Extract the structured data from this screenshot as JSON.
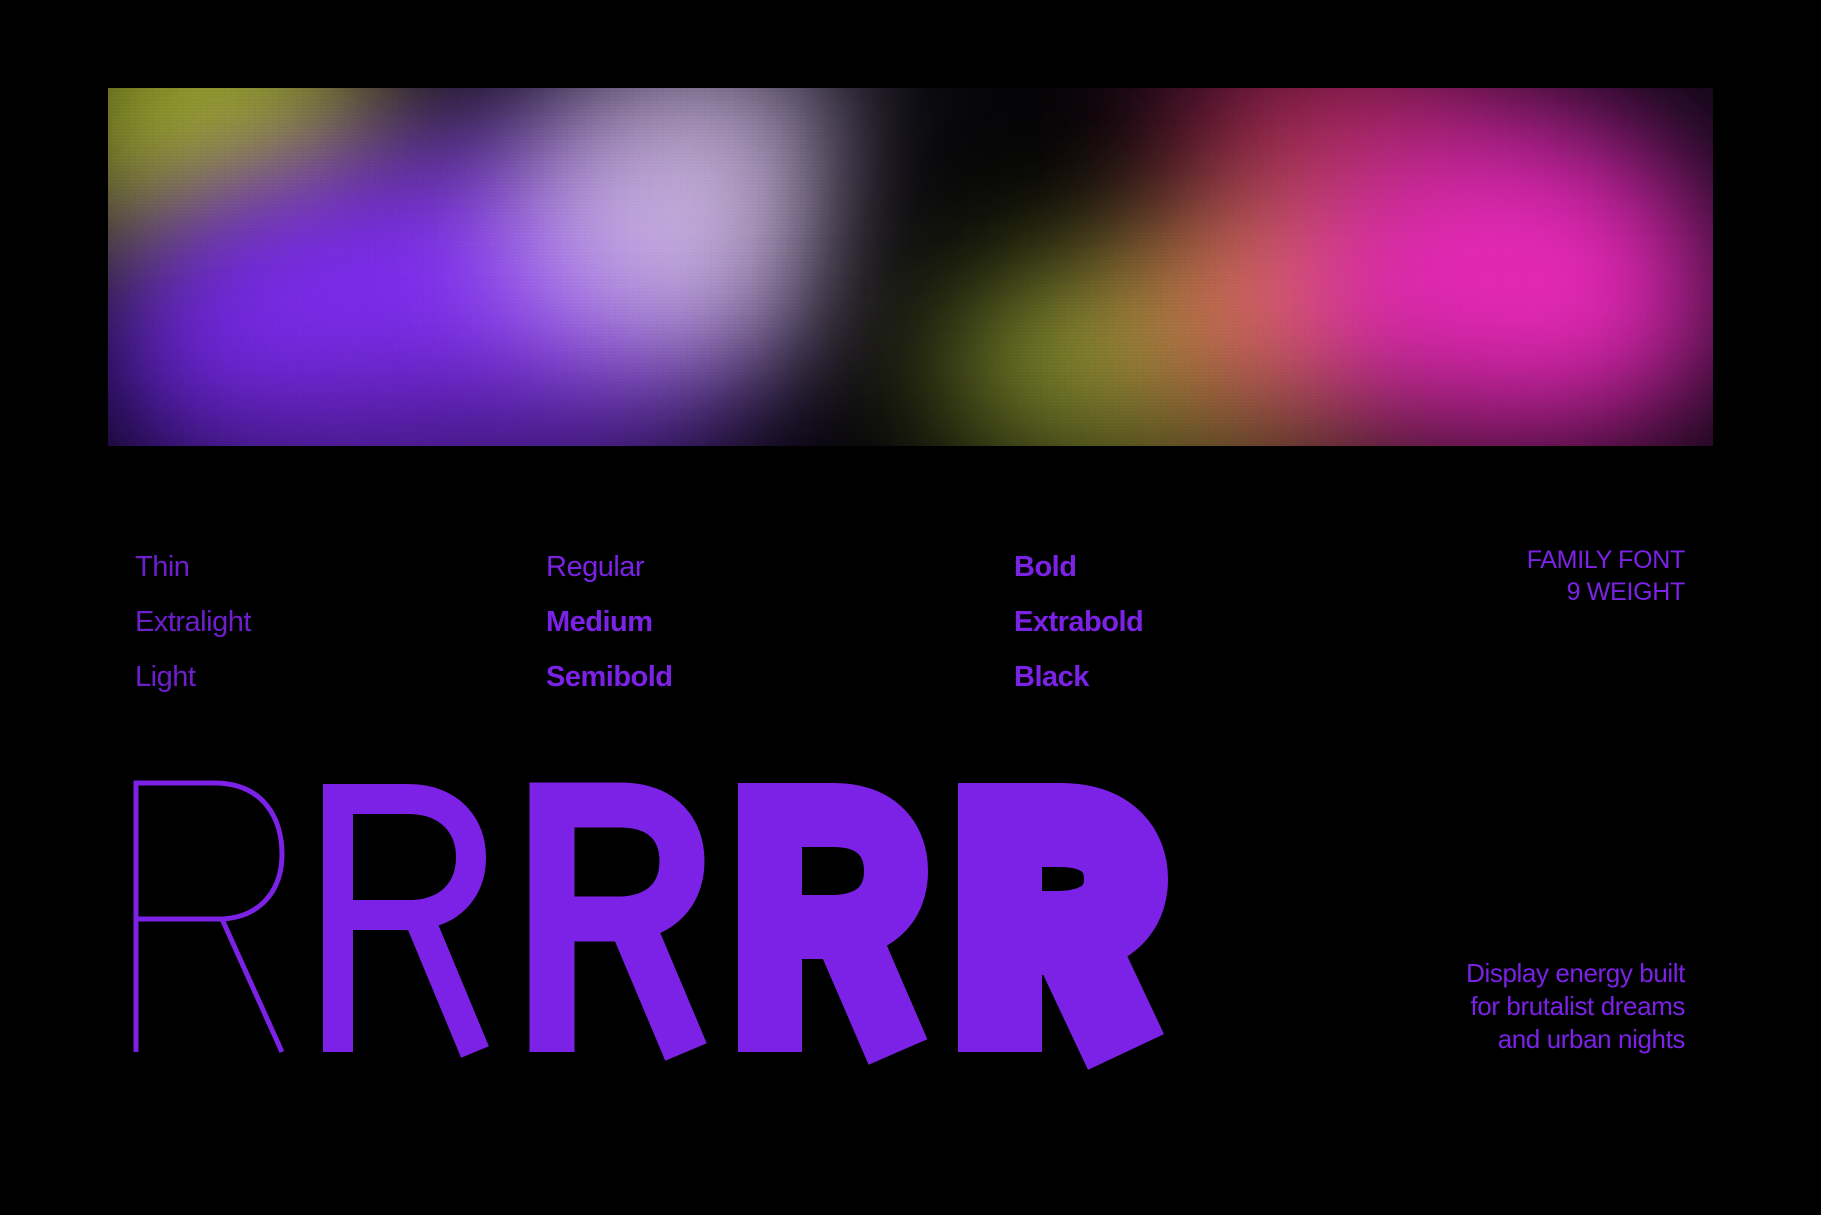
{
  "colors": {
    "background": "#000000",
    "accent": "#7B22E6"
  },
  "banner": {
    "description_icon": "gradient-banner"
  },
  "weights": {
    "column1": [
      "Thin",
      "Extralight",
      "Light"
    ],
    "column2": [
      "Regular",
      "Medium",
      "Semibold"
    ],
    "column3": [
      "Bold",
      "Extrabold",
      "Black"
    ]
  },
  "family": {
    "line1": "FAMILY FONT",
    "line2": "9 WEIGHT"
  },
  "glyphs": [
    "R",
    "R",
    "R",
    "R",
    "R"
  ],
  "tagline": {
    "line1": "Display energy built",
    "line2": "for brutalist dreams",
    "line3": "and urban nights"
  }
}
